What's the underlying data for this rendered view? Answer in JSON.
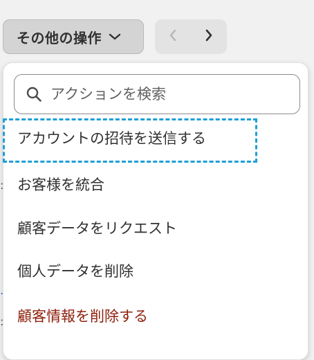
{
  "toolbar": {
    "more_actions_label": "その他の操作",
    "prev_icon": "chevron-left-icon",
    "next_icon": "chevron-right-icon"
  },
  "search": {
    "placeholder": "アクションを検索",
    "value": ""
  },
  "menu": {
    "items": [
      {
        "label": "アカウントの招待を送信する",
        "state": "focused"
      },
      {
        "label": "お客様を統合"
      },
      {
        "label": "顧客データをリクエスト"
      },
      {
        "label": "個人データを削除"
      },
      {
        "label": "顧客情報を削除する",
        "tone": "critical"
      }
    ]
  },
  "colors": {
    "focus_ring": "#1d9fd6",
    "critical_text": "#8e1f0b",
    "panel_bg": "#ffffff",
    "page_bg": "#f1f1f1"
  }
}
